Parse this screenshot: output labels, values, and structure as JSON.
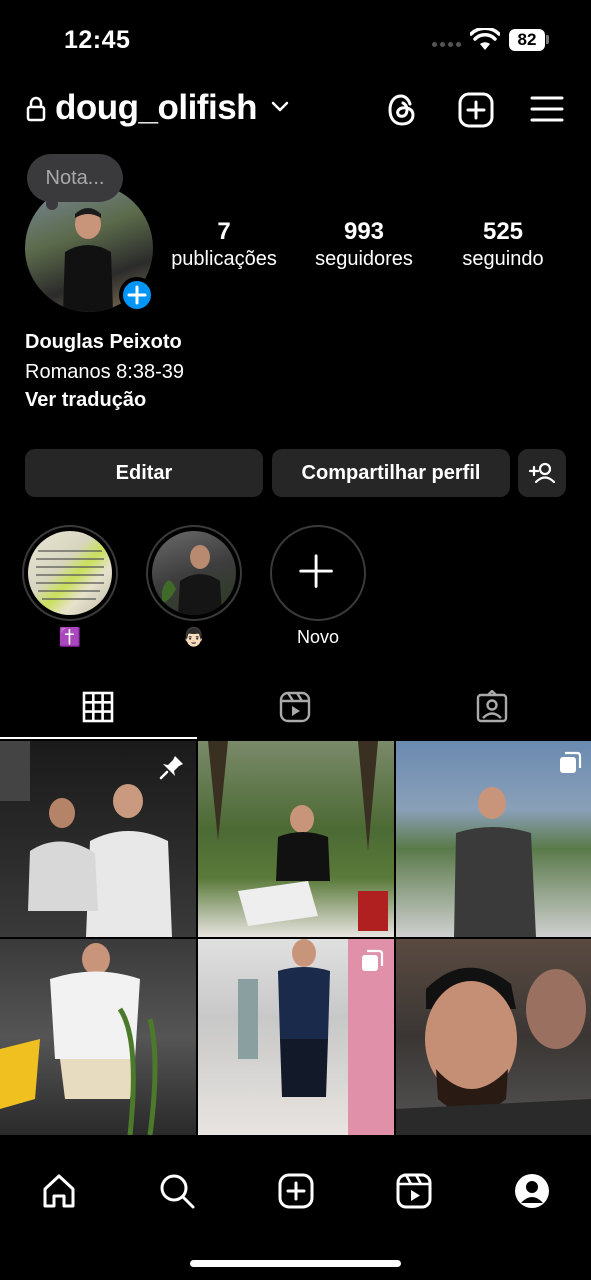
{
  "status_bar": {
    "time": "12:45",
    "battery": "82"
  },
  "header": {
    "username": "doug_olifish"
  },
  "profile": {
    "note_placeholder": "Nota...",
    "stats": [
      {
        "value": "7",
        "label": "publicações"
      },
      {
        "value": "993",
        "label": "seguidores"
      },
      {
        "value": "525",
        "label": "seguindo"
      }
    ],
    "name": "Douglas Peixoto",
    "bio": "Romanos 8:38-39",
    "translate_label": "Ver tradução"
  },
  "actions": {
    "edit_label": "Editar",
    "share_label": "Compartilhar perfil"
  },
  "highlights": [
    {
      "label": "✝️"
    },
    {
      "label": "👨🏻"
    },
    {
      "label": "Novo"
    }
  ],
  "tabs": [
    "grid-icon",
    "reels-icon",
    "tagged-icon"
  ],
  "colors": {
    "background": "#000000",
    "button": "#262626",
    "accent": "#0095f6",
    "note_bubble": "#3a3a3c"
  },
  "bottom_nav": [
    "home-icon",
    "search-icon",
    "create-icon",
    "reels-icon",
    "profile-icon"
  ]
}
